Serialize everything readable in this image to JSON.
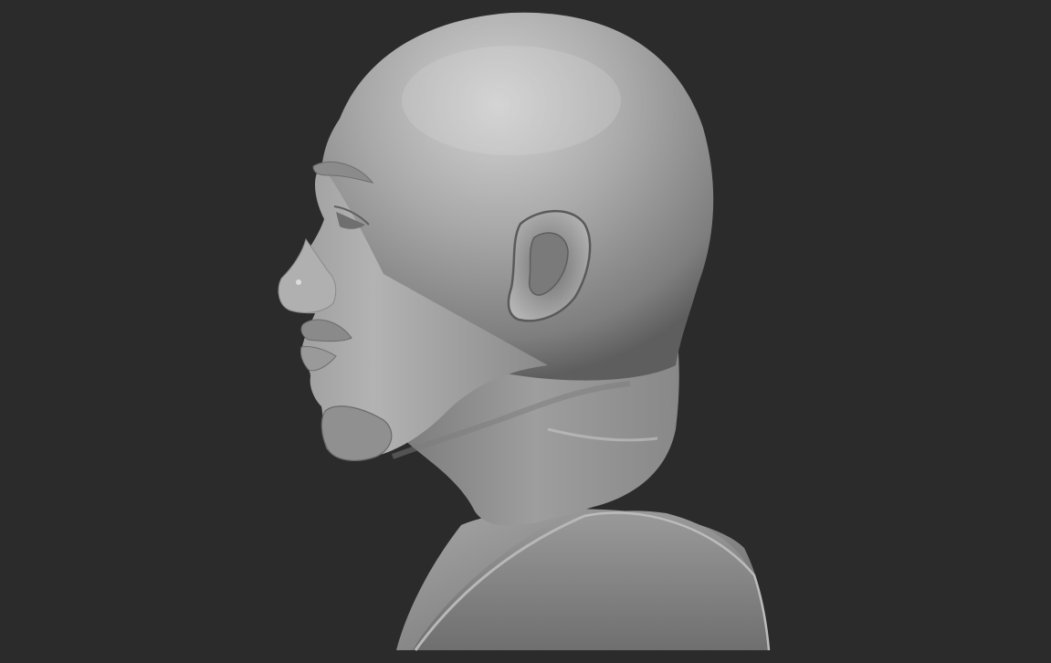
{
  "viewport": {
    "background_color": "#2b2b2b"
  },
  "model": {
    "subject": "bust",
    "view": "left profile",
    "material_color": "#8c8c8c"
  }
}
